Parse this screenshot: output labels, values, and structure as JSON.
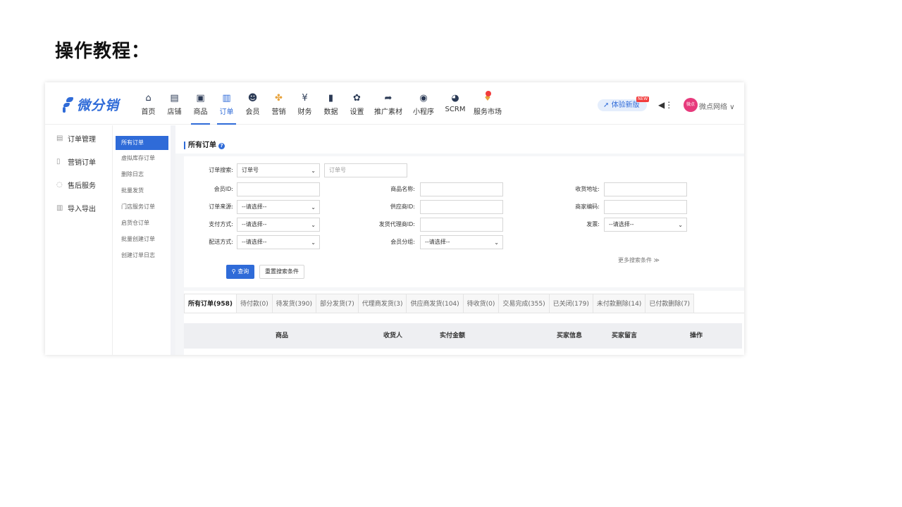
{
  "page": {
    "title": "操作教程："
  },
  "app": {
    "logo_text": "微分销",
    "nav": [
      {
        "label": "首页",
        "icon": "home-icon",
        "glyph": "⌂"
      },
      {
        "label": "店铺",
        "icon": "store-icon",
        "glyph": "▤"
      },
      {
        "label": "商品",
        "icon": "goods-icon",
        "glyph": "▣"
      },
      {
        "label": "订单",
        "icon": "order-icon",
        "glyph": "▥"
      },
      {
        "label": "会员",
        "icon": "member-icon",
        "glyph": "☻"
      },
      {
        "label": "营销",
        "icon": "marketing-icon",
        "glyph": "✤"
      },
      {
        "label": "财务",
        "icon": "finance-icon",
        "glyph": "¥"
      },
      {
        "label": "数据",
        "icon": "data-icon",
        "glyph": "▮"
      },
      {
        "label": "设置",
        "icon": "settings-icon",
        "glyph": "✿"
      },
      {
        "label": "推广素材",
        "icon": "share-icon",
        "glyph": "➦"
      },
      {
        "label": "小程序",
        "icon": "miniprogram-icon",
        "glyph": "◉"
      },
      {
        "label": "SCRM",
        "icon": "scrm-icon",
        "glyph": "◕"
      },
      {
        "label": "服务市场",
        "icon": "service-market-icon",
        "glyph": "♦"
      }
    ],
    "try_new": "体验新版",
    "new_tag": "NEW",
    "avatar_text": "微点",
    "shop_name": "微点网络",
    "accent_color": "#2f6bd8"
  },
  "sidebar": {
    "items": [
      {
        "label": "订单管理",
        "icon": "list-icon",
        "glyph": "▤"
      },
      {
        "label": "营销订单",
        "icon": "doc-icon",
        "glyph": "▯"
      },
      {
        "label": "售后服务",
        "icon": "headset-icon",
        "glyph": "◌"
      },
      {
        "label": "导入导出",
        "icon": "import-icon",
        "glyph": "▥"
      }
    ]
  },
  "subnav": {
    "items": [
      "所有订单",
      "虚拟库存订单",
      "删除日志",
      "批量发货",
      "门店服务订单",
      "启货仓订单",
      "批量创建订单",
      "创建订单日志"
    ]
  },
  "main": {
    "title": "所有订单",
    "help": "?"
  },
  "search": {
    "order_search_label": "订单搜索:",
    "order_search_type": "订单号",
    "order_search_placeholder": "订单号",
    "member_id_label": "会员ID:",
    "goods_name_label": "商品名称:",
    "address_label": "收货地址:",
    "order_source_label": "订单来源:",
    "supplier_id_label": "供应商ID:",
    "merchant_code_label": "商家编码:",
    "pay_method_label": "支付方式:",
    "agent_id_label": "发货代理商ID:",
    "invoice_label": "发票:",
    "delivery_label": "配送方式:",
    "member_group_label": "会员分组:",
    "select_default": "--请选择--",
    "more_search": "更多搜索条件 ≫",
    "query_button": "查询",
    "reset_button": "重置搜索条件"
  },
  "orders": {
    "tabs": [
      "所有订单(958)",
      "待付款(0)",
      "待发货(390)",
      "部分发货(7)",
      "代理商发货(3)",
      "供应商发货(104)",
      "待收货(0)",
      "交易完成(355)",
      "已关闭(179)",
      "未付款删除(14)",
      "已付款删除(7)"
    ],
    "columns": [
      "商品",
      "收货人",
      "实付金额",
      "买家信息",
      "买家留言",
      "操作"
    ]
  }
}
